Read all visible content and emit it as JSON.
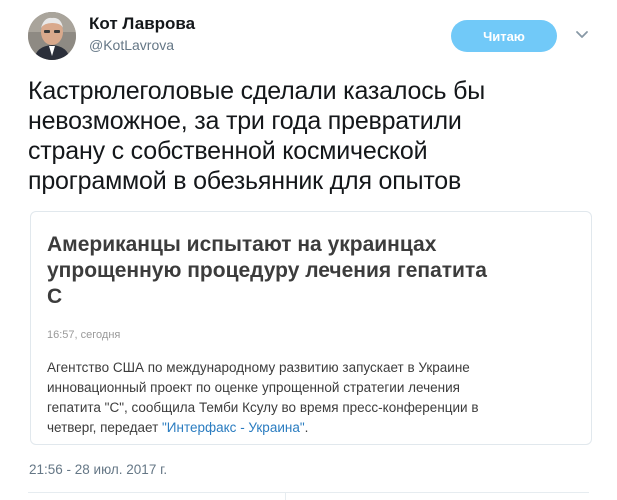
{
  "author": {
    "display_name": "Кот Лаврова",
    "handle": "@KotLavrova"
  },
  "follow_button": {
    "label": "Читаю"
  },
  "tweet": {
    "line1": "Кастрюлеголовые сделали казалось бы",
    "line2": "невозможное, за три года превратили",
    "line3": "страну с собственной космической",
    "line4": "программой в обезьянник для опытов"
  },
  "card": {
    "title_line1": "Американцы испытают на украинцах",
    "title_line2": "упрощенную процедуру лечения гепатита",
    "title_line3": "С",
    "time": "16:57, сегодня",
    "body_line1": "Агентство США по международному развитию запускает в Украине",
    "body_line2": "инновационный проект по оценке упрощенной стратегии лечения",
    "body_line3": "гепатита \"С\", сообщила Темби Ксулу во время пресс-конференции в",
    "body_line4_prefix": "четверг, передает ",
    "body_link": "\"Интерфакс - Украина\"",
    "body_line4_suffix": "."
  },
  "timestamp": "21:56 - 28 июл. 2017 г."
}
